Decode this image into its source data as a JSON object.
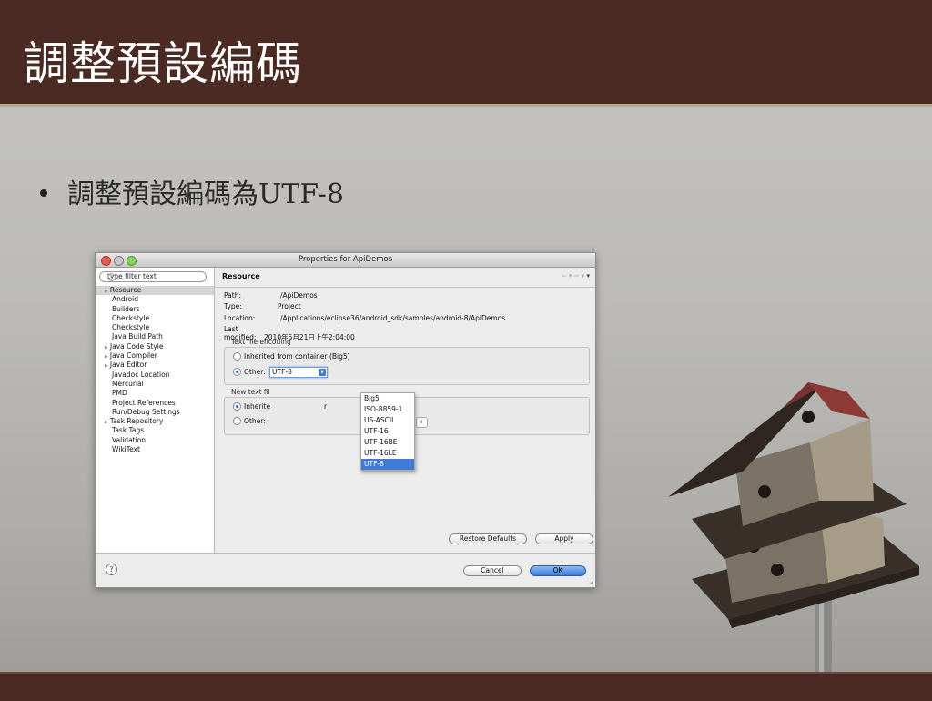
{
  "slide": {
    "title": "調整預設編碼",
    "bullet": "調整預設編碼為UTF-8"
  },
  "window": {
    "title": "Properties for ApiDemos",
    "filter_placeholder": "type filter text",
    "tree": [
      {
        "label": "Resource",
        "selected": true,
        "expandable": true
      },
      {
        "label": "Android"
      },
      {
        "label": "Builders"
      },
      {
        "label": "Checkstyle"
      },
      {
        "label": "Checkstyle"
      },
      {
        "label": "Java Build Path"
      },
      {
        "label": "Java Code Style",
        "expandable": true
      },
      {
        "label": "Java Compiler",
        "expandable": true
      },
      {
        "label": "Java Editor",
        "expandable": true
      },
      {
        "label": "Javadoc Location"
      },
      {
        "label": "Mercurial"
      },
      {
        "label": "PMD"
      },
      {
        "label": "Project References"
      },
      {
        "label": "Run/Debug Settings"
      },
      {
        "label": "Task Repository",
        "expandable": true
      },
      {
        "label": "Task Tags"
      },
      {
        "label": "Validation"
      },
      {
        "label": "WikiText"
      }
    ],
    "page_heading": "Resource",
    "info": {
      "path_label": "Path:",
      "path_value": "/ApiDemos",
      "type_label": "Type:",
      "type_value": "Project",
      "location_label": "Location:",
      "location_value": "/Applications/eclipse36/android_sdk/samples/android-8/ApiDemos",
      "modified_label": "Last modified:",
      "modified_value": "2010年5月21日上午2:04:00"
    },
    "encoding": {
      "group_title": "Text file encoding",
      "inherited_label": "Inherited from container (Big5)",
      "other_label": "Other:",
      "other_value": "UTF-8"
    },
    "line_delim": {
      "group_title": "New text fil",
      "inherited_label": "Inherite",
      "inherited_suffix": "r",
      "other_label": "Other:"
    },
    "dropdown_options": [
      "Big5",
      "ISO-8859-1",
      "US-ASCII",
      "UTF-16",
      "UTF-16BE",
      "UTF-16LE",
      "UTF-8"
    ],
    "dropdown_selected": "UTF-8",
    "buttons": {
      "restore": "Restore Defaults",
      "apply": "Apply",
      "cancel": "Cancel",
      "ok": "OK"
    },
    "help_glyph": "?"
  }
}
